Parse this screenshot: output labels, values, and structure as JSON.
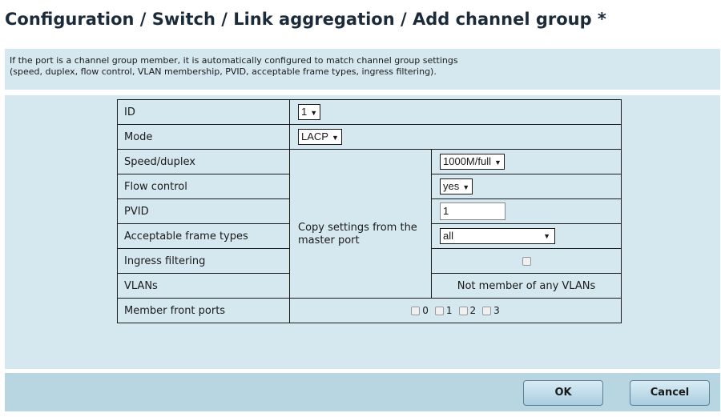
{
  "page_title": "Configuration / Switch / Link aggregation / Add channel group *",
  "info_text": [
    "If the port is a channel group member, it is automatically configured to match channel group settings",
    "(speed, duplex, flow control, VLAN membership, PVID, acceptable frame types, ingress filtering)."
  ],
  "form": {
    "id": {
      "label": "ID",
      "value": "1"
    },
    "mode": {
      "label": "Mode",
      "value": "LACP"
    },
    "copy_settings_label": "Copy settings from the master port",
    "speed_duplex": {
      "label": "Speed/duplex",
      "value": "1000M/full"
    },
    "flow_control": {
      "label": "Flow control",
      "value": "yes"
    },
    "pvid": {
      "label": "PVID",
      "value": "1"
    },
    "acceptable_frame_types": {
      "label": "Acceptable frame types",
      "value": "all"
    },
    "ingress_filtering": {
      "label": "Ingress filtering",
      "checked": false
    },
    "vlans": {
      "label": "VLANs",
      "value": "Not member of any VLANs"
    },
    "member_front_ports": {
      "label": "Member front ports",
      "ports": [
        {
          "label": "0",
          "checked": false
        },
        {
          "label": "1",
          "checked": false
        },
        {
          "label": "2",
          "checked": false
        },
        {
          "label": "3",
          "checked": false
        }
      ]
    }
  },
  "buttons": {
    "ok": "OK",
    "cancel": "Cancel"
  },
  "colors": {
    "panel": "#d5e8f0",
    "button_bar": "#b8d6e2",
    "title": "#1c2b3a"
  },
  "icons": {
    "dropdown": "dropdown-arrow-icon",
    "checkbox": "checkbox-icon"
  }
}
